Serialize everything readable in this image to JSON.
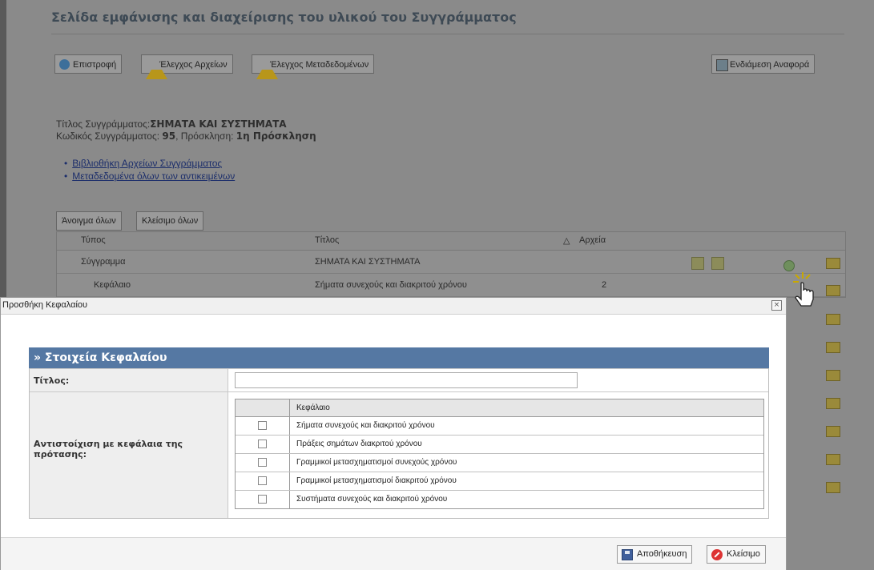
{
  "page": {
    "title": "Σελίδα εμφάνισης και διαχείρισης του υλικού του Συγγράμματος",
    "toolbar": {
      "back": "Επιστροφή",
      "check_files": "Έλεγχος Αρχείων",
      "check_metadata": "Έλεγχος Μεταδεδομένων",
      "interim_report": "Ενδιάμεση Αναφορά"
    },
    "meta": {
      "title_label": "Τίτλος Συγγράμματος:",
      "title_value": "ΣΗΜΑΤΑ ΚΑΙ ΣΥΣΤΗΜΑΤΑ",
      "code_label": "Κωδικός Συγγράμματος: ",
      "code_value": "95",
      "invite_label": ", Πρόσκληση: ",
      "invite_value": "1η Πρόσκληση"
    },
    "links": [
      "Βιβλιοθήκη Αρχείων Συγγράμματος",
      "Μεταδεδομένα όλων των αντικειμένων"
    ],
    "expand_all": "Άνοιγμα όλων",
    "collapse_all": "Κλείσιμο όλων",
    "grid": {
      "headers": {
        "type": "Τύπος",
        "title": "Τίτλος",
        "sort": "△",
        "files": "Αρχεία"
      },
      "rows": [
        {
          "type": "Σύγγραμμα",
          "title": "ΣΗΜΑΤΑ ΚΑΙ ΣΥΣΤΗΜΑΤΑ",
          "files": ""
        },
        {
          "type": "Κεφάλαιο",
          "title": "Σήματα συνεχούς και διακριτού χρόνου",
          "files": "2"
        }
      ]
    }
  },
  "dialog": {
    "title": "Προσθήκη Κεφαλαίου",
    "close": "×",
    "section": "» Στοιχεία Κεφαλαίου",
    "title_label": "Τίτλος:",
    "title_value": "",
    "mapping_label": "Αντιστοίχιση με κεφάλαια της πρότασης:",
    "chapters_header": "Κεφάλαιο",
    "chapters": [
      "Σήματα συνεχούς και διακριτού χρόνου",
      "Πράξεις σημάτων διακριτού χρόνου",
      "Γραμμικοί μετασχηματισμοί συνεχούς χρόνου",
      "Γραμμικοί μετασχηματισμοί διακριτού χρόνου",
      "Συστήματα συνεχούς και διακριτού χρόνου"
    ],
    "save": "Αποθήκευση",
    "cancel": "Κλείσιμο"
  }
}
